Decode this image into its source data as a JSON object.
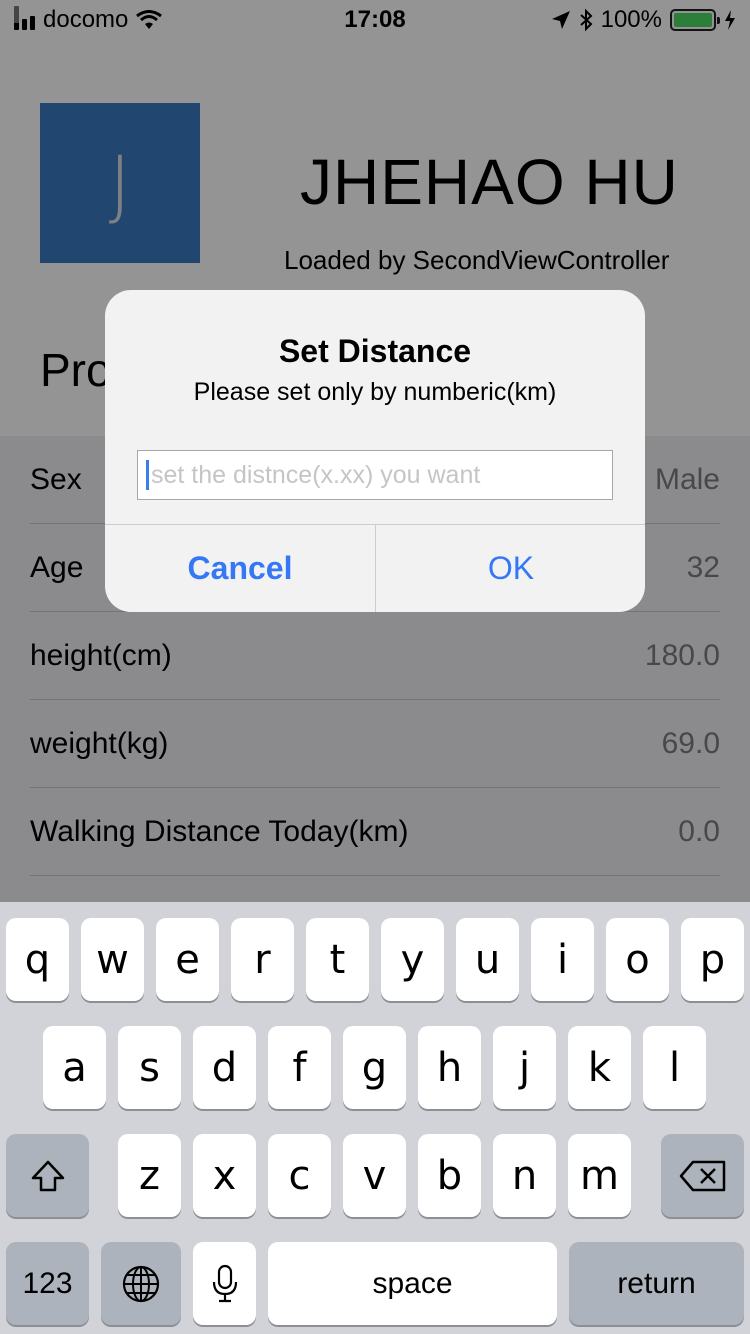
{
  "status": {
    "carrier": "docomo",
    "time": "17:08",
    "battery": "100%"
  },
  "profile": {
    "avatar_letter": "J",
    "name": "JHEHAO HU",
    "loaded_by": "Loaded by SecondViewController",
    "section_title": "Profile"
  },
  "rows": [
    {
      "label": "Sex",
      "value": "Male"
    },
    {
      "label": "Age",
      "value": "32"
    },
    {
      "label": "height(cm)",
      "value": "180.0"
    },
    {
      "label": "weight(kg)",
      "value": "69.0"
    },
    {
      "label": "Walking Distance Today(km)",
      "value": "0.0"
    }
  ],
  "alert": {
    "title": "Set Distance",
    "message": "Please set only by numberic(km)",
    "placeholder": "set the distnce(x.xx) you want",
    "cancel": "Cancel",
    "ok": "OK"
  },
  "keyboard": {
    "row1": [
      "q",
      "w",
      "e",
      "r",
      "t",
      "y",
      "u",
      "i",
      "o",
      "p"
    ],
    "row2": [
      "a",
      "s",
      "d",
      "f",
      "g",
      "h",
      "j",
      "k",
      "l"
    ],
    "row3": [
      "z",
      "x",
      "c",
      "v",
      "b",
      "n",
      "m"
    ],
    "numbers": "123",
    "space": "space",
    "return": "return"
  },
  "colors": {
    "accent": "#3478f6",
    "avatar": "#3a7ac3",
    "battery": "#4cd964"
  }
}
